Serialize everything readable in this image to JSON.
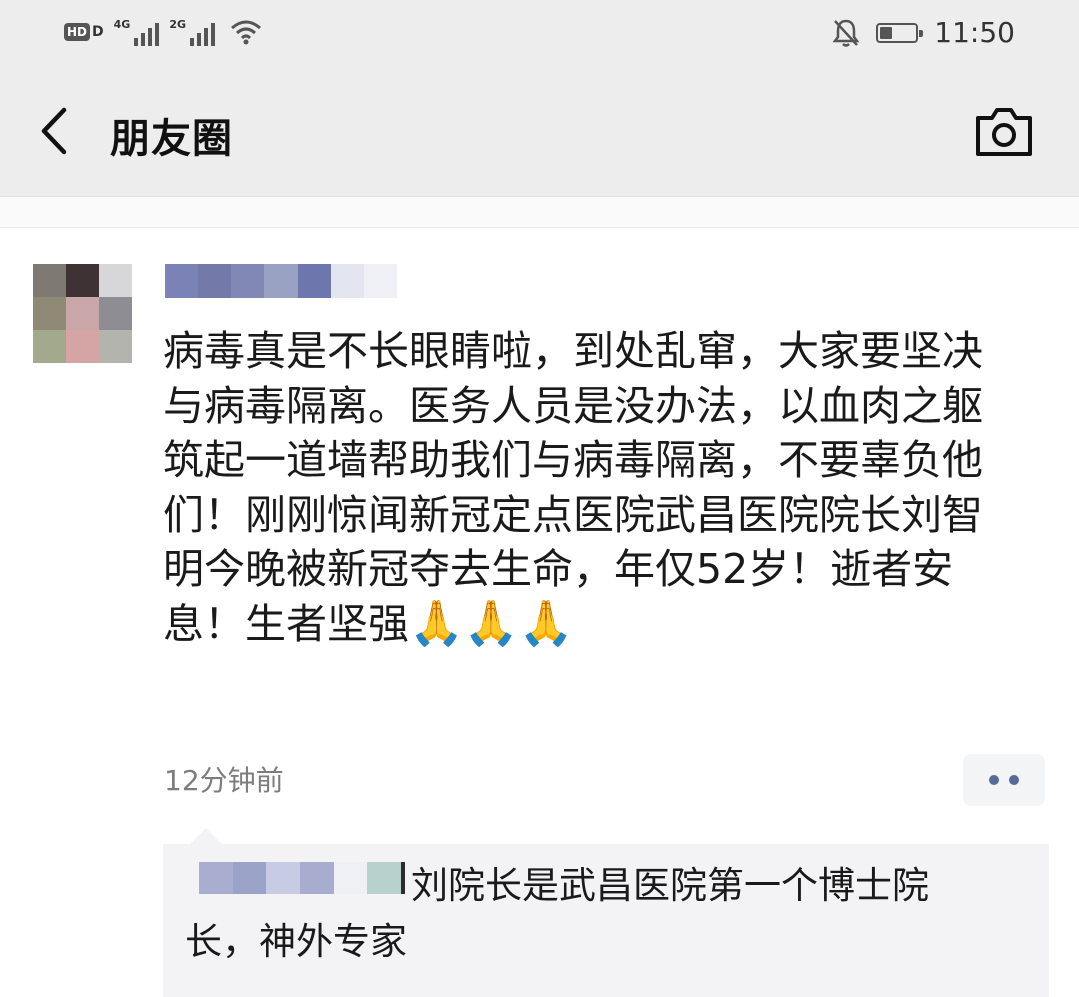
{
  "status_bar": {
    "hd": "HD",
    "hd_sub": "D",
    "sim1_network": "4G",
    "sim2_network": "2G",
    "battery_level": 0.35,
    "time": "11:50",
    "icons": [
      "hd-icon",
      "signal-icon",
      "signal-icon",
      "wifi-icon",
      "mute-bell-icon",
      "battery-icon"
    ]
  },
  "nav": {
    "title": "朋友圈",
    "back_icon": "chevron-left-icon",
    "camera_icon": "camera-icon"
  },
  "post": {
    "text": "病毒真是不长眼睛啦，到处乱窜，大家要坚决与病毒隔离。医务人员是没办法，以血肉之躯筑起一道墙帮助我们与病毒隔离，不要辜负他们！刚刚惊闻新冠定点医院武昌医院院长刘智明今晚被新冠夺去生命，年仅52岁！逝者安息！生者坚强",
    "emoji": [
      "🙏",
      "🙏",
      "🙏"
    ],
    "time": "12分钟前",
    "more_icon": "more-dots-icon"
  },
  "comment": {
    "text": "刘院长是武昌医院第一个博士院长，神外专家"
  },
  "colors": {
    "header_bg": "#ededed",
    "link_blue": "#586b94",
    "comment_bg": "#f3f3f5",
    "timestamp_gray": "#7d7d7d"
  }
}
